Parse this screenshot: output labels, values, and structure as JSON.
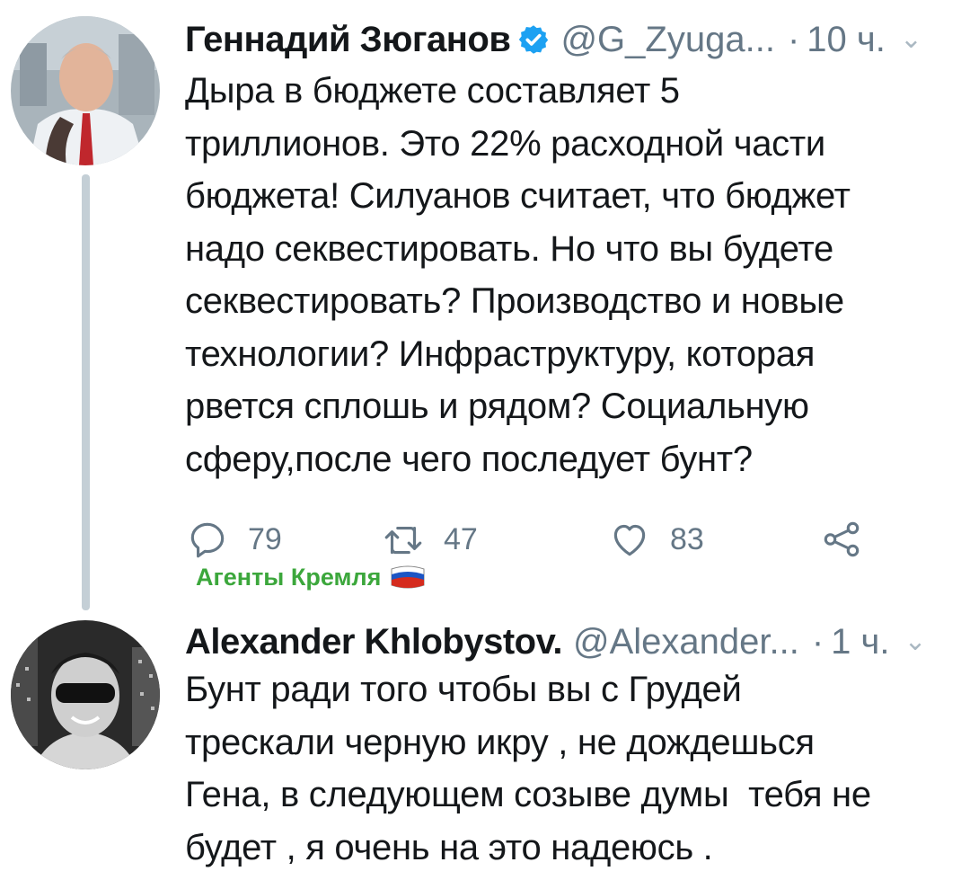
{
  "tweets": [
    {
      "author_name": "Геннадий Зюганов",
      "handle": "@G_Zyuga...",
      "separator": "·",
      "time": "10 ч.",
      "text": "Дыра в бюджете составляет 5 триллионов. Это 22% расходной части бюджета! Силуанов считает, что бюджет надо секвестировать. Но что вы будете секвестировать? Производство и новые технологии? Инфраструктуру, которая рвется сплошь и рядом? Социальную сферу,после чего последует бунт?",
      "text_lines": [
        "Дыра в бюджете составляет 5",
        "триллионов. Это 22% расходной части",
        "бюджета! Силуанов считает, что бюджет",
        "надо секвестировать. Но что вы будете",
        "секвестировать? Производство и новые",
        "технологии? Инфраструктуру, которая",
        "рвется сплошь и рядом? Социальную",
        "сферу,после чего последует бунт?"
      ],
      "verified": true,
      "replies": "79",
      "retweets": "47",
      "likes": "83",
      "icons": {
        "reply": "reply-icon",
        "retweet": "retweet-icon",
        "like": "heart-icon",
        "share": "share-icon",
        "verified": "verified-badge-icon",
        "more": "chevron-down-icon"
      }
    },
    {
      "author_name": "Alexander Khlobystov.",
      "handle": "@Alexander...",
      "separator": "·",
      "time": "1 ч.",
      "text": "Бунт ради того чтобы вы с Грудей трескали черную икру , не дождешься Гена, в следующем созыве думы тебя не будет , я очень на это надеюсь .",
      "text_lines": [
        "Бунт ради того чтобы вы с Грудей",
        "трескали черную икру , не дождешься",
        "Гена, в следующем созыве думы  тебя не",
        "будет , я очень на это надеюсь ."
      ],
      "verified": false
    }
  ],
  "watermark": {
    "text": "Агенты Кремля",
    "icon": "russian-flag-icon"
  },
  "colors": {
    "text": "#14171a",
    "secondary": "#657786",
    "verified_blue": "#1da1f2",
    "thread_line": "#c4cfd6",
    "watermark_green": "#3ca73c"
  }
}
